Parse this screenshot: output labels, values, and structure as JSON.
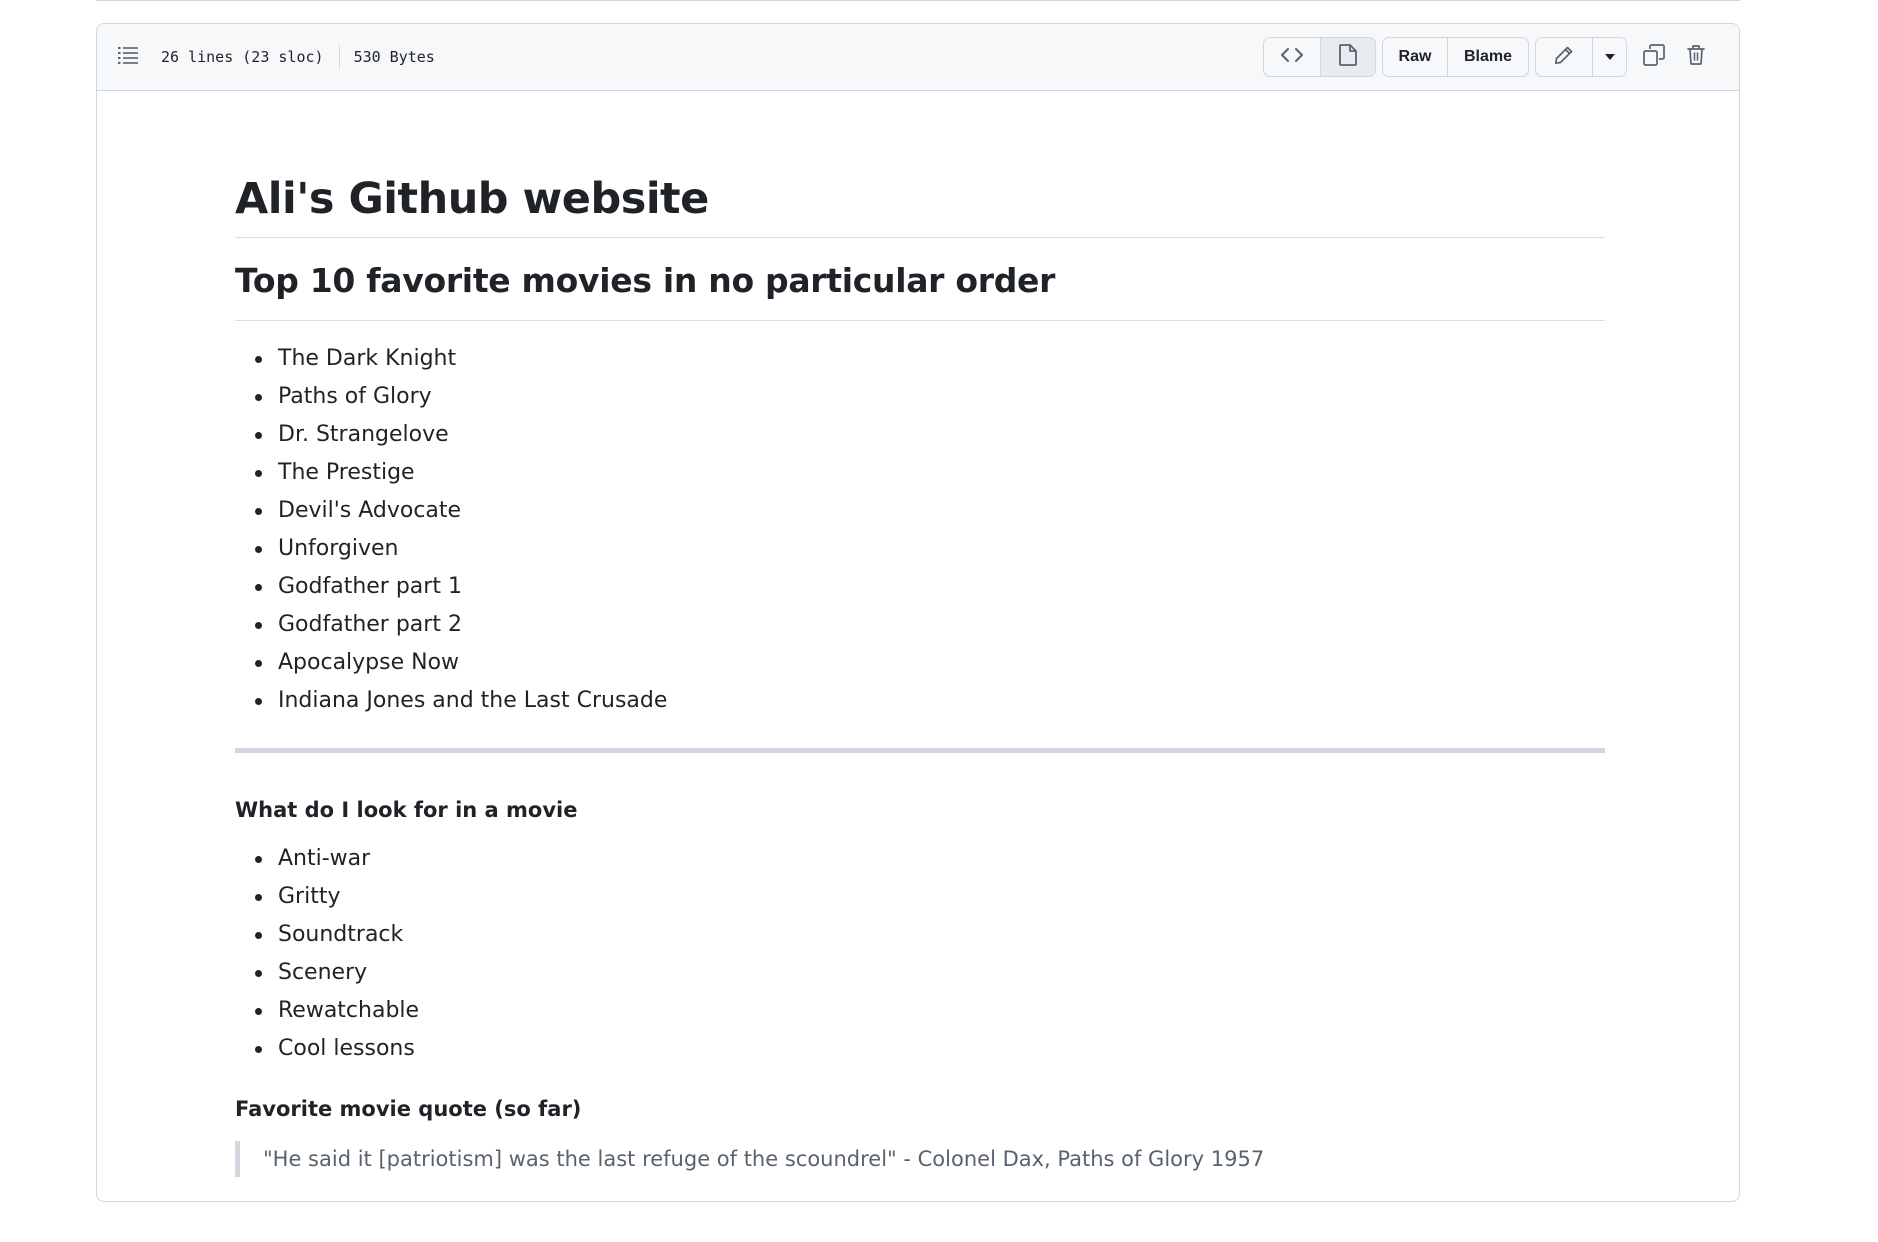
{
  "file_header": {
    "line_info": "26 lines (23 sloc)",
    "size": "530 Bytes",
    "outline_icon": "list-unordered-icon",
    "code_view_icon": "code-icon",
    "preview_icon": "file-icon",
    "raw_label": "Raw",
    "blame_label": "Blame",
    "edit_icon": "pencil-icon",
    "more_icon": "triangle-down-icon",
    "copy_icon": "copy-icon",
    "delete_icon": "trash-icon"
  },
  "readme": {
    "title": "Ali's Github website",
    "movies_heading": "Top 10 favorite movies in no particular order",
    "movies": [
      "The Dark Knight",
      "Paths of Glory",
      "Dr. Strangelove",
      "The Prestige",
      "Devil's Advocate",
      "Unforgiven",
      "Godfather part 1",
      "Godfather part 2",
      "Apocalypse Now",
      "Indiana Jones and the Last Crusade"
    ],
    "criteria_heading": "What do I look for in a movie",
    "criteria": [
      "Anti-war",
      "Gritty",
      "Soundtrack",
      "Scenery",
      "Rewatchable",
      "Cool lessons"
    ],
    "quote_heading": "Favorite movie quote (so far)",
    "quote": "\"He said it [patriotism] was the last refuge of the scoundrel\" - Colonel Dax, Paths of Glory 1957"
  },
  "colors": {
    "text": "#1f2328",
    "muted": "#59636e",
    "border": "#d0d7de",
    "header_bg": "#f6f8fa"
  }
}
